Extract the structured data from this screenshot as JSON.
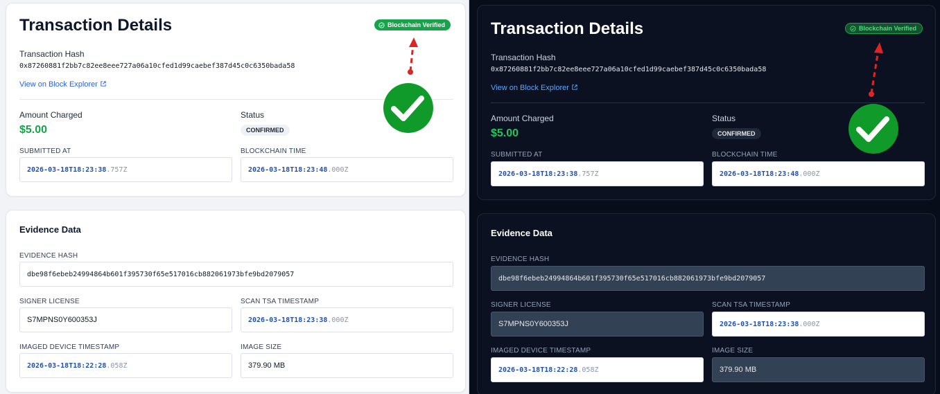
{
  "panels": [
    {
      "theme": "light",
      "transaction": {
        "title": "Transaction Details",
        "badge": "Blockchain Verified",
        "hash_label": "Transaction Hash",
        "hash": "0x87260881f2bb7c82ee8eee727a06a10cfed1d99caebef387d45c0c6350bada58",
        "explorer_link": "View on Block Explorer",
        "amount_label": "Amount Charged",
        "amount": "$5.00",
        "status_label": "Status",
        "status": "CONFIRMED",
        "submitted_label": "SUBMITTED AT",
        "submitted_main": "2026-03-18T18:23:38",
        "submitted_ms": ".757Z",
        "chain_time_label": "BLOCKCHAIN TIME",
        "chain_time_main": "2026-03-18T18:23:48",
        "chain_time_ms": ".000Z"
      },
      "evidence": {
        "title": "Evidence Data",
        "hash_label": "EVIDENCE HASH",
        "hash": "dbe98f6ebeb24994864b601f395730f65e517016cb882061973bfe9bd2079057",
        "signer_label": "SIGNER LICENSE",
        "signer": "S7MPNS0Y600353J",
        "tsa_label": "SCAN TSA TIMESTAMP",
        "tsa_main": "2026-03-18T18:23:38",
        "tsa_ms": ".000Z",
        "device_label": "IMAGED DEVICE TIMESTAMP",
        "device_main": "2026-03-18T18:22:28",
        "device_ms": ".058Z",
        "size_label": "IMAGE SIZE",
        "size": "379.90 MB"
      }
    },
    {
      "theme": "dark",
      "transaction": {
        "title": "Transaction Details",
        "badge": "Blockchain Verified",
        "hash_label": "Transaction Hash",
        "hash": "0x87260881f2bb7c82ee8eee727a06a10cfed1d99caebef387d45c0c6350bada58",
        "explorer_link": "View on Block Explorer",
        "amount_label": "Amount Charged",
        "amount": "$5.00",
        "status_label": "Status",
        "status": "CONFIRMED",
        "submitted_label": "SUBMITTED AT",
        "submitted_main": "2026-03-18T18:23:38",
        "submitted_ms": ".757Z",
        "chain_time_label": "BLOCKCHAIN TIME",
        "chain_time_main": "2026-03-18T18:23:48",
        "chain_time_ms": ".000Z"
      },
      "evidence": {
        "title": "Evidence Data",
        "hash_label": "EVIDENCE HASH",
        "hash": "dbe98f6ebeb24994864b601f395730f65e517016cb882061973bfe9bd2079057",
        "signer_label": "SIGNER LICENSE",
        "signer": "S7MPNS0Y600353J",
        "tsa_label": "SCAN TSA TIMESTAMP",
        "tsa_main": "2026-03-18T18:23:38",
        "tsa_ms": ".000Z",
        "device_label": "IMAGED DEVICE TIMESTAMP",
        "device_main": "2026-03-18T18:22:28",
        "device_ms": ".058Z",
        "size_label": "IMAGE SIZE",
        "size": "379.90 MB"
      }
    }
  ],
  "colors": {
    "success": "#16a34a",
    "link": "#2563eb",
    "annotation_arrow": "#dc2626",
    "checkmark_circle": "#109a2a"
  },
  "icons": [
    "check-circle-icon",
    "external-link-icon",
    "checkmark-badge-icon",
    "red-dashed-arrow"
  ]
}
